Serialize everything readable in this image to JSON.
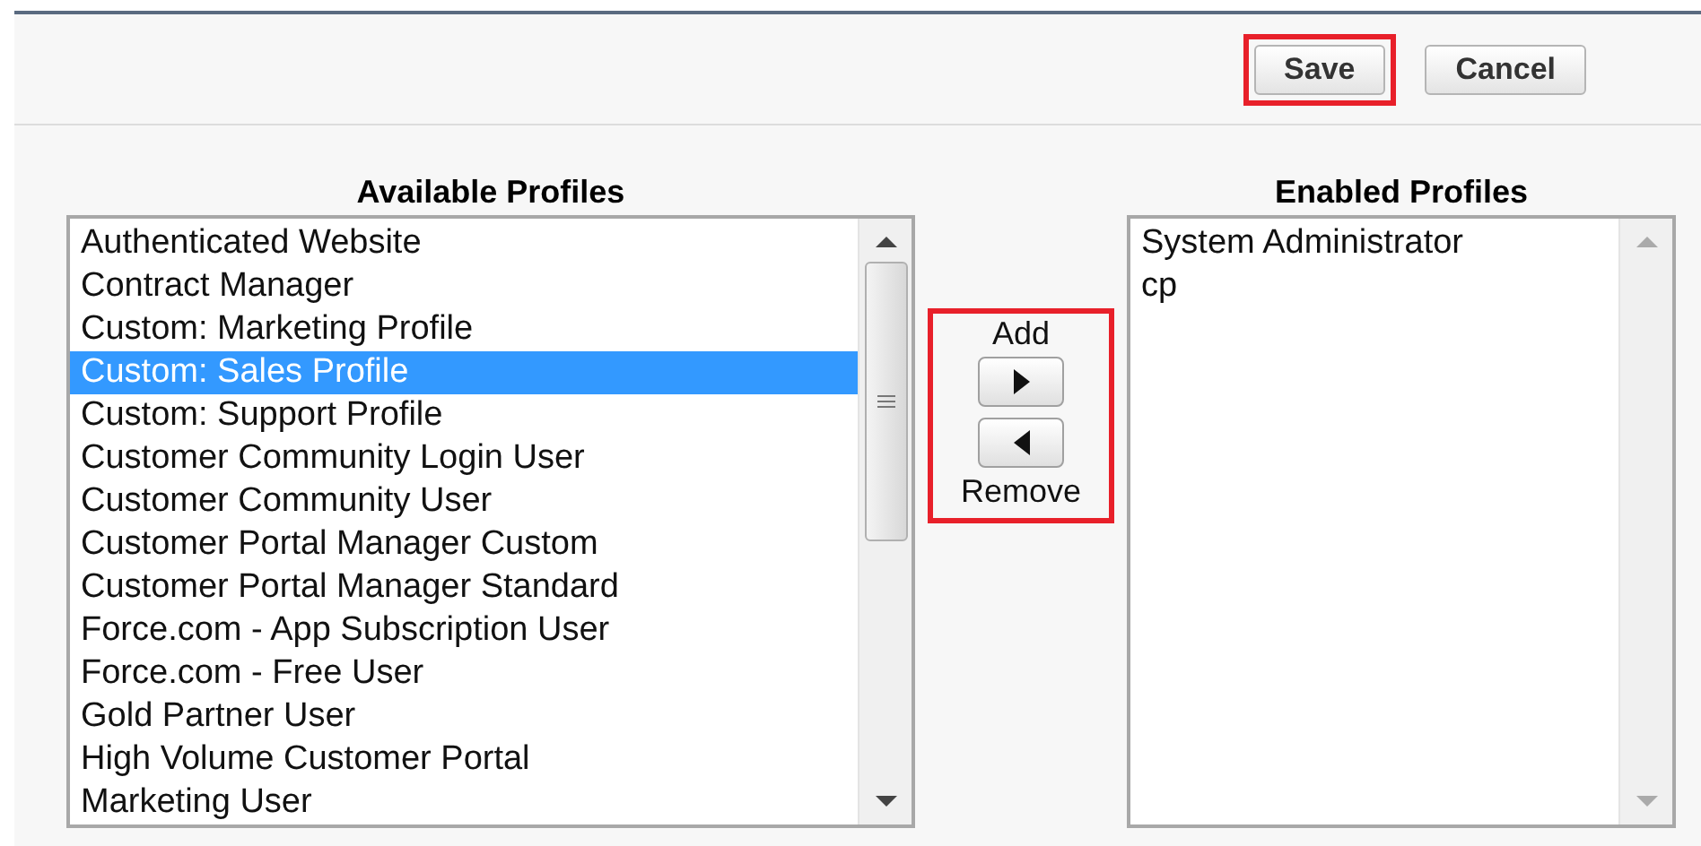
{
  "toolbar": {
    "buttons": [
      {
        "label": "Save",
        "highlighted": true
      },
      {
        "label": "Cancel",
        "highlighted": false
      }
    ]
  },
  "available": {
    "heading": "Available Profiles",
    "items": [
      {
        "label": "Authenticated Website",
        "selected": false
      },
      {
        "label": "Contract Manager",
        "selected": false
      },
      {
        "label": "Custom: Marketing Profile",
        "selected": false
      },
      {
        "label": "Custom: Sales Profile",
        "selected": true
      },
      {
        "label": "Custom: Support Profile",
        "selected": false
      },
      {
        "label": "Customer Community Login User",
        "selected": false
      },
      {
        "label": "Customer Community User",
        "selected": false
      },
      {
        "label": "Customer Portal Manager Custom",
        "selected": false
      },
      {
        "label": "Customer Portal Manager Standard",
        "selected": false
      },
      {
        "label": "Force.com - App Subscription User",
        "selected": false
      },
      {
        "label": "Force.com - Free User",
        "selected": false
      },
      {
        "label": "Gold Partner User",
        "selected": false
      },
      {
        "label": "High Volume Customer Portal",
        "selected": false
      },
      {
        "label": "Marketing User",
        "selected": false
      }
    ]
  },
  "mover": {
    "add_label": "Add",
    "remove_label": "Remove",
    "highlighted": true
  },
  "enabled": {
    "heading": "Enabled Profiles",
    "items": [
      {
        "label": "System Administrator",
        "selected": false
      },
      {
        "label": "cp",
        "selected": false
      }
    ]
  }
}
